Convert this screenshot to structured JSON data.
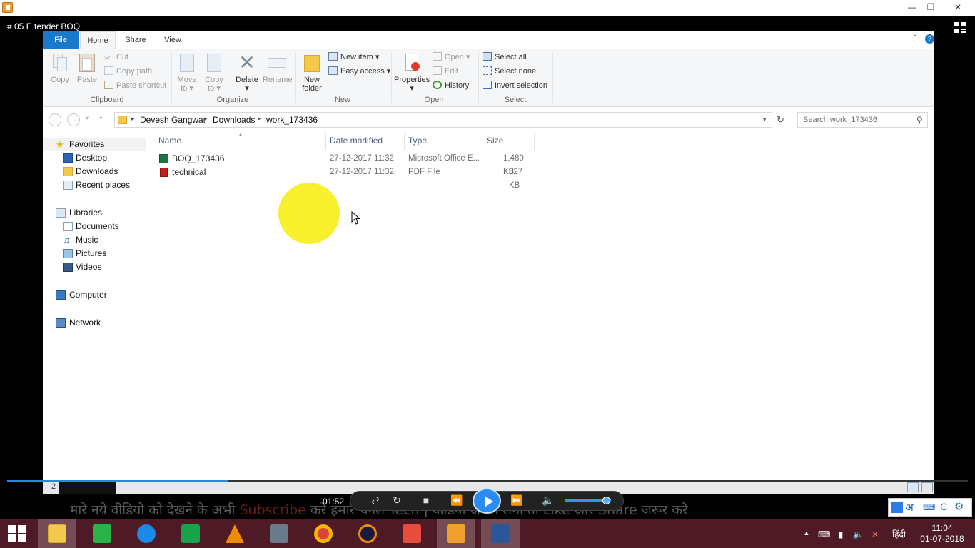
{
  "video": {
    "title": "# 05  E tender  BOQ"
  },
  "ribbon": {
    "tabs": {
      "file": "File",
      "home": "Home",
      "share": "Share",
      "view": "View"
    },
    "clipboard": {
      "copy": "Copy",
      "paste": "Paste",
      "cut": "Cut",
      "copy_path": "Copy path",
      "paste_shortcut": "Paste shortcut",
      "label": "Clipboard"
    },
    "organize": {
      "move_to": "Move",
      "move_to2": "to",
      "copy_to": "Copy",
      "copy_to2": "to",
      "delete": "Delete",
      "rename": "Rename",
      "label": "Organize"
    },
    "new": {
      "new_folder": "New",
      "new_folder2": "folder",
      "new_item": "New item",
      "easy_access": "Easy access",
      "label": "New"
    },
    "open": {
      "properties": "Properties",
      "open": "Open",
      "edit": "Edit",
      "history": "History",
      "label": "Open"
    },
    "select": {
      "select_all": "Select all",
      "select_none": "Select none",
      "invert": "Invert selection",
      "label": "Select"
    }
  },
  "address": {
    "crumbs": [
      "Devesh Gangwar",
      "Downloads",
      "work_173436"
    ],
    "search_placeholder": "Search work_173436"
  },
  "navpane": {
    "favorites": "Favorites",
    "desktop": "Desktop",
    "downloads": "Downloads",
    "recent": "Recent places",
    "libraries": "Libraries",
    "documents": "Documents",
    "music": "Music",
    "pictures": "Pictures",
    "videos": "Videos",
    "computer": "Computer",
    "network": "Network"
  },
  "filelist": {
    "columns": {
      "name": "Name",
      "date": "Date modified",
      "type": "Type",
      "size": "Size"
    },
    "rows": [
      {
        "name": "BOQ_173436",
        "date": "27-12-2017 11:32",
        "type": "Microsoft Office E...",
        "size": "1,480 KB"
      },
      {
        "name": "technical",
        "date": "27-12-2017 11:32",
        "type": "PDF File",
        "size": "627 KB"
      }
    ]
  },
  "player": {
    "time": "01:52",
    "page_num": "2",
    "progress": 0.23,
    "ticker_a": "मारे नये वीडियो को देखने के अभी ",
    "ticker_b": "Subscribe",
    "ticker_c": " करे हमारे चैनल ",
    "ticker_d": "Tech",
    "ticker_e": " | वीडियो अच्छा लगा तो Like और Share जरूर करे"
  },
  "taskbar": {
    "lang": "हिंदी",
    "time": "11:04",
    "date": "01-07-2018"
  },
  "colors": {
    "accent": "#1979ca",
    "taskbar": "#4d1a26",
    "highlight": "#f7ef1a"
  }
}
